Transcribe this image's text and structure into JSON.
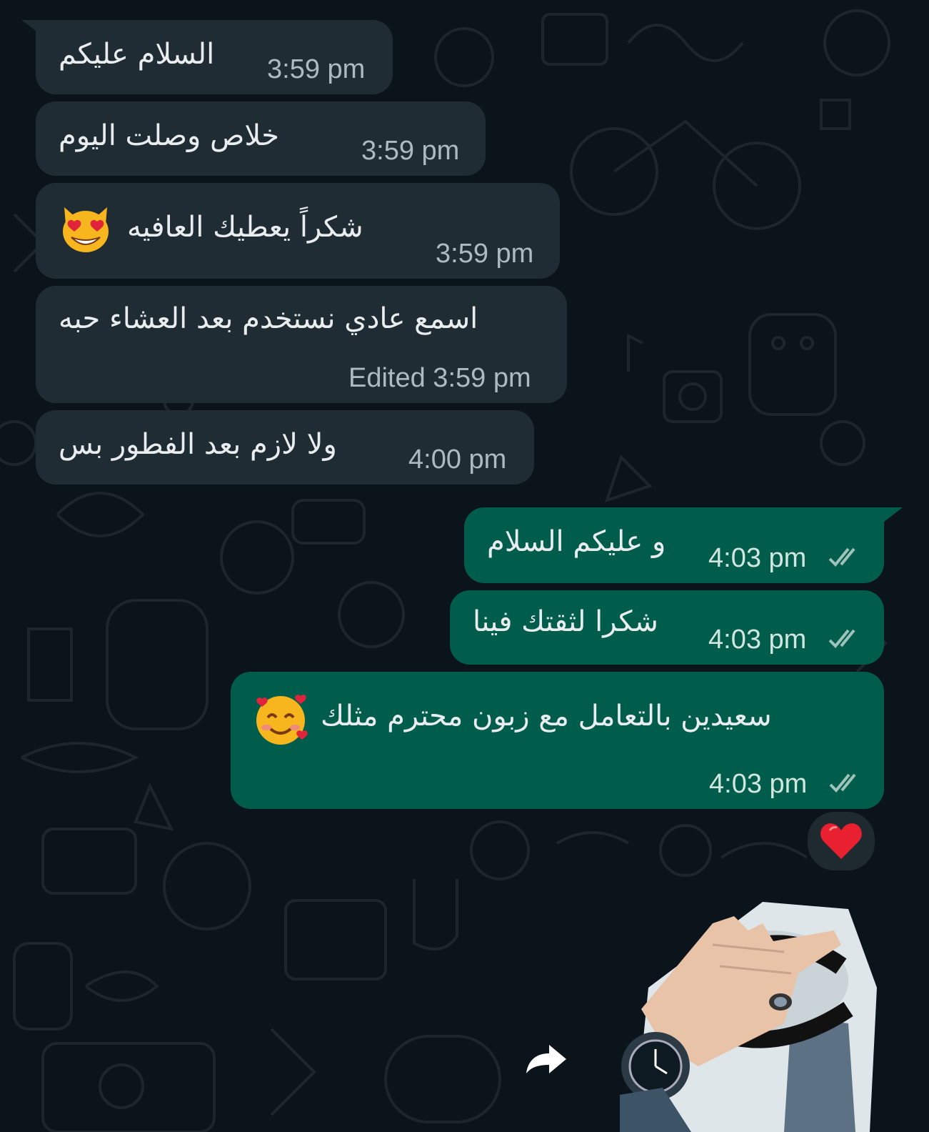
{
  "messages": {
    "incoming": [
      {
        "text": "السلام عليكم",
        "time": "3:59 pm"
      },
      {
        "text": "خلاص وصلت اليوم",
        "time": "3:59 pm"
      },
      {
        "text": "شكراً يعطيك العافيه",
        "time": "3:59 pm",
        "emoji": "heart-eyes-cat-emoji"
      },
      {
        "text": "اسمع عادي نستخدم بعد العشاء حبه",
        "time": "Edited 3:59 pm"
      },
      {
        "text": "ولا لازم بعد الفطور بس",
        "time": "4:00 pm"
      }
    ],
    "outgoing": [
      {
        "text": "و عليكم السلام",
        "time": "4:03 pm",
        "status": "read-double-check-icon"
      },
      {
        "text": "شكرا لثقتك فينا",
        "time": "4:03 pm",
        "status": "read-double-check-icon"
      },
      {
        "text": "سعيدين بالتعامل مع زبون محترم مثلك",
        "time": "4:03 pm",
        "status": "read-double-check-icon",
        "emoji": "smiling-face-with-hearts-emoji"
      }
    ]
  },
  "reaction": {
    "icon": "red-heart-icon"
  },
  "colors": {
    "background": "#0b141a",
    "incoming_bubble": "#202c33",
    "outgoing_bubble": "#005c4b",
    "text": "#e9edef",
    "timestamp": "#aebac1"
  }
}
